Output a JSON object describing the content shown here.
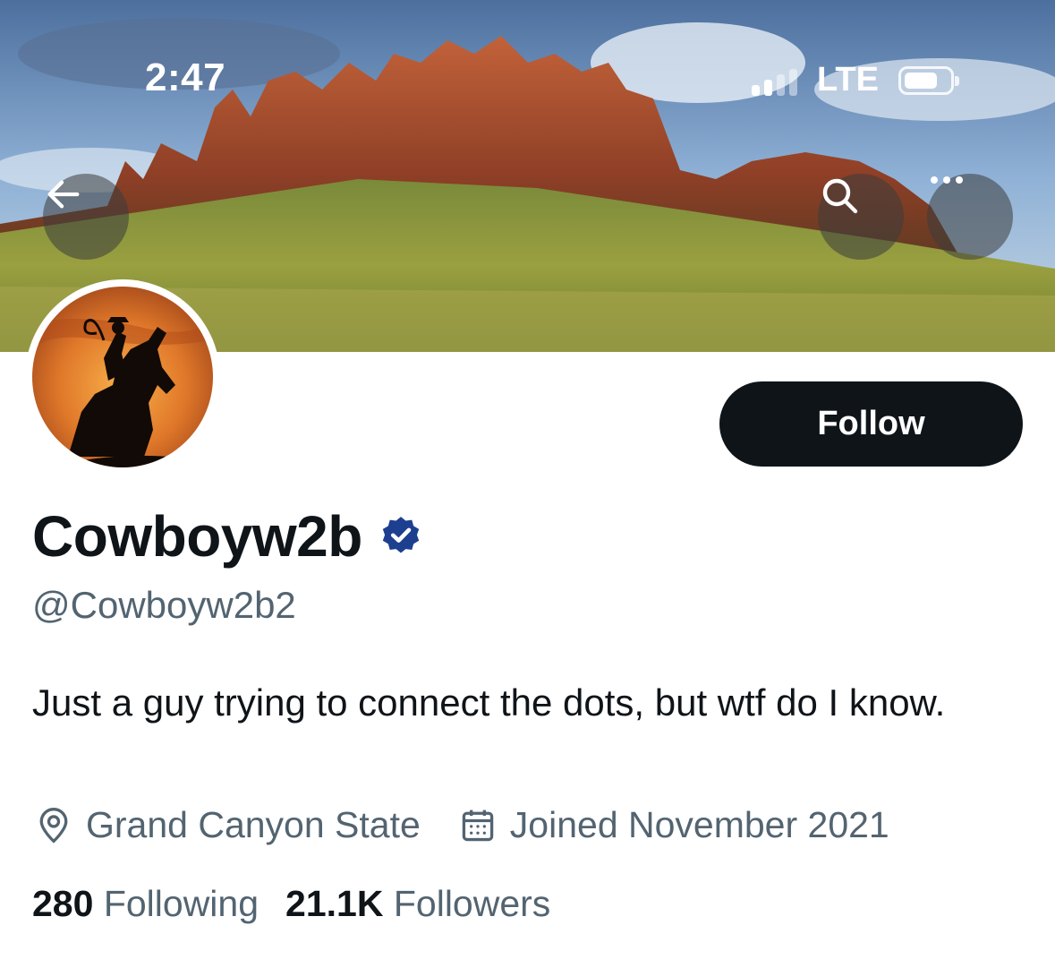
{
  "status_bar": {
    "time": "2:47",
    "network": "LTE",
    "signal_bars_active": 2,
    "signal_bars_total": 4
  },
  "header": {
    "back_icon": "arrow-left-icon",
    "search_icon": "search-icon",
    "more_icon": "more-horizontal-icon"
  },
  "profile": {
    "display_name": "Cowboyw2b",
    "verified": true,
    "handle": "@Cowboyw2b2",
    "bio": "Just a guy trying to connect the dots, but wtf do I know.",
    "location": "Grand Canyon State",
    "joined": "Joined November 2021",
    "following_count": "280",
    "following_label": "Following",
    "followers_count": "21.1K",
    "followers_label": "Followers",
    "follow_label": "Follow"
  },
  "colors": {
    "text_primary": "#0f1419",
    "text_secondary": "#536471",
    "verified_badge": "#1d3f8f",
    "follow_button": "#0f1419"
  }
}
